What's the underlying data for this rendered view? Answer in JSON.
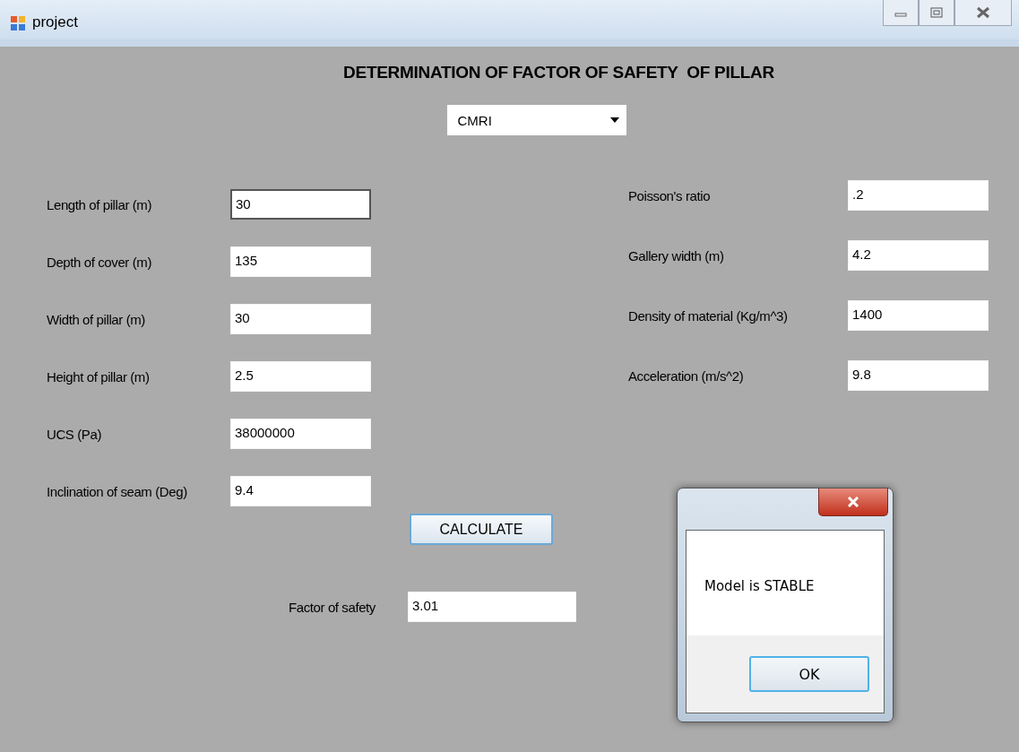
{
  "window": {
    "title": "project"
  },
  "heading": "DETERMINATION OF FACTOR OF SAFETY  OF PILLAR",
  "method_dropdown": {
    "value": "CMRI"
  },
  "left_fields": [
    {
      "label": "Length of pillar (m)",
      "value": "30",
      "focused": true
    },
    {
      "label": "Depth of cover (m)",
      "value": "135",
      "focused": false
    },
    {
      "label": "Width of pillar (m)",
      "value": "30",
      "focused": false
    },
    {
      "label": "Height of pillar (m)",
      "value": "2.5",
      "focused": false
    },
    {
      "label": "UCS (Pa)",
      "value": "38000000",
      "focused": false
    },
    {
      "label": "Inclination of seam (Deg)",
      "value": "9.4",
      "focused": false
    }
  ],
  "right_fields": [
    {
      "label": "Poisson's ratio",
      "value": ".2",
      "focused": false
    },
    {
      "label": "Gallery width (m)",
      "value": "4.2",
      "focused": false
    },
    {
      "label": "Density of material (Kg/m^3)",
      "value": "1400",
      "focused": false
    },
    {
      "label": "Acceleration (m/s^2)",
      "value": "9.8",
      "focused": false
    }
  ],
  "calculate_button": "CALCULATE",
  "result": {
    "label": "Factor of safety",
    "value": "3.01"
  },
  "message_box": {
    "message": "Model is STABLE",
    "button": "OK"
  }
}
